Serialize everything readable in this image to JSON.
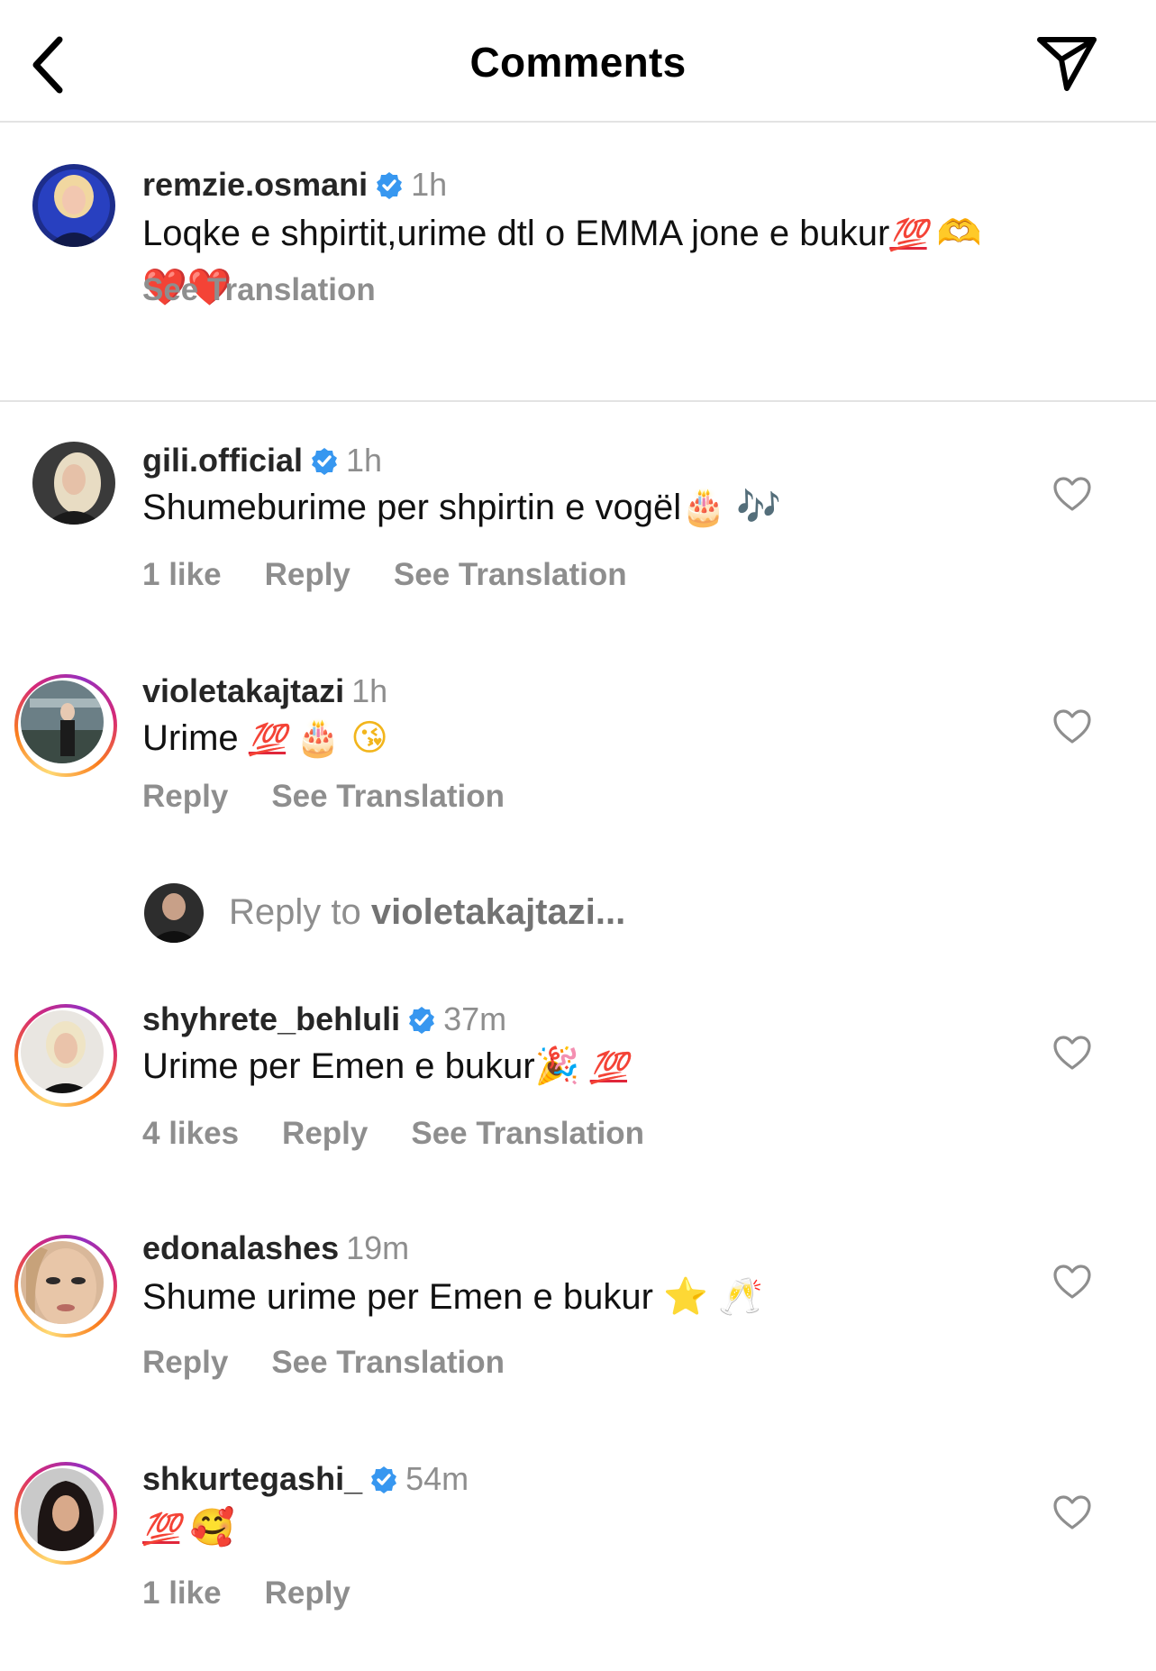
{
  "header": {
    "title": "Comments",
    "back_icon": "chevron-left-icon",
    "share_icon": "paper-plane-icon"
  },
  "caption": {
    "username": "remzie.osmani",
    "verified": true,
    "time": "1h",
    "text": "Loqke e shpirtit,urime dtl o EMMA jone e bukur",
    "emoji_1": "💯",
    "emoji_2": "🫶",
    "emoji_3": "❤️",
    "emoji_4": "❤️",
    "see_translation": "See Translation"
  },
  "comments": [
    {
      "username": "gili.official",
      "verified": true,
      "time": "1h",
      "text": "Shumeburime per shpirtin e vogël",
      "emoji_1": "🎂",
      "emoji_2": "🎶",
      "likes": "1 like",
      "reply": "Reply",
      "see_translation": "See Translation"
    },
    {
      "username": "violetakajtazi",
      "verified": false,
      "time": "1h",
      "text": "Urime",
      "emoji_1": "💯",
      "emoji_2": "🎂",
      "emoji_3": "😘",
      "reply": "Reply",
      "see_translation": "See Translation"
    },
    {
      "username": "shyhrete_behluli",
      "verified": true,
      "time": "37m",
      "text": "Urime per Emen e bukur",
      "emoji_1": "🎉",
      "emoji_2": "💯",
      "likes": "4 likes",
      "reply": "Reply",
      "see_translation": "See Translation"
    },
    {
      "username": "edonalashes",
      "verified": false,
      "time": "19m",
      "text": "Shume urime per Emen e bukur",
      "emoji_1": "⭐",
      "emoji_2": "🥂",
      "reply": "Reply",
      "see_translation": "See Translation"
    },
    {
      "username": "shkurtegashi_",
      "verified": true,
      "time": "54m",
      "text": "",
      "emoji_1": "💯",
      "emoji_2": "🥰",
      "likes": "1 like",
      "reply": "Reply"
    }
  ],
  "reply_prompt": {
    "prefix": "Reply to ",
    "target": "violetakajtazi..."
  },
  "colors": {
    "verified": "#3797f0",
    "secondary_text": "#8e8e8e",
    "divider": "#e3e3e3"
  }
}
